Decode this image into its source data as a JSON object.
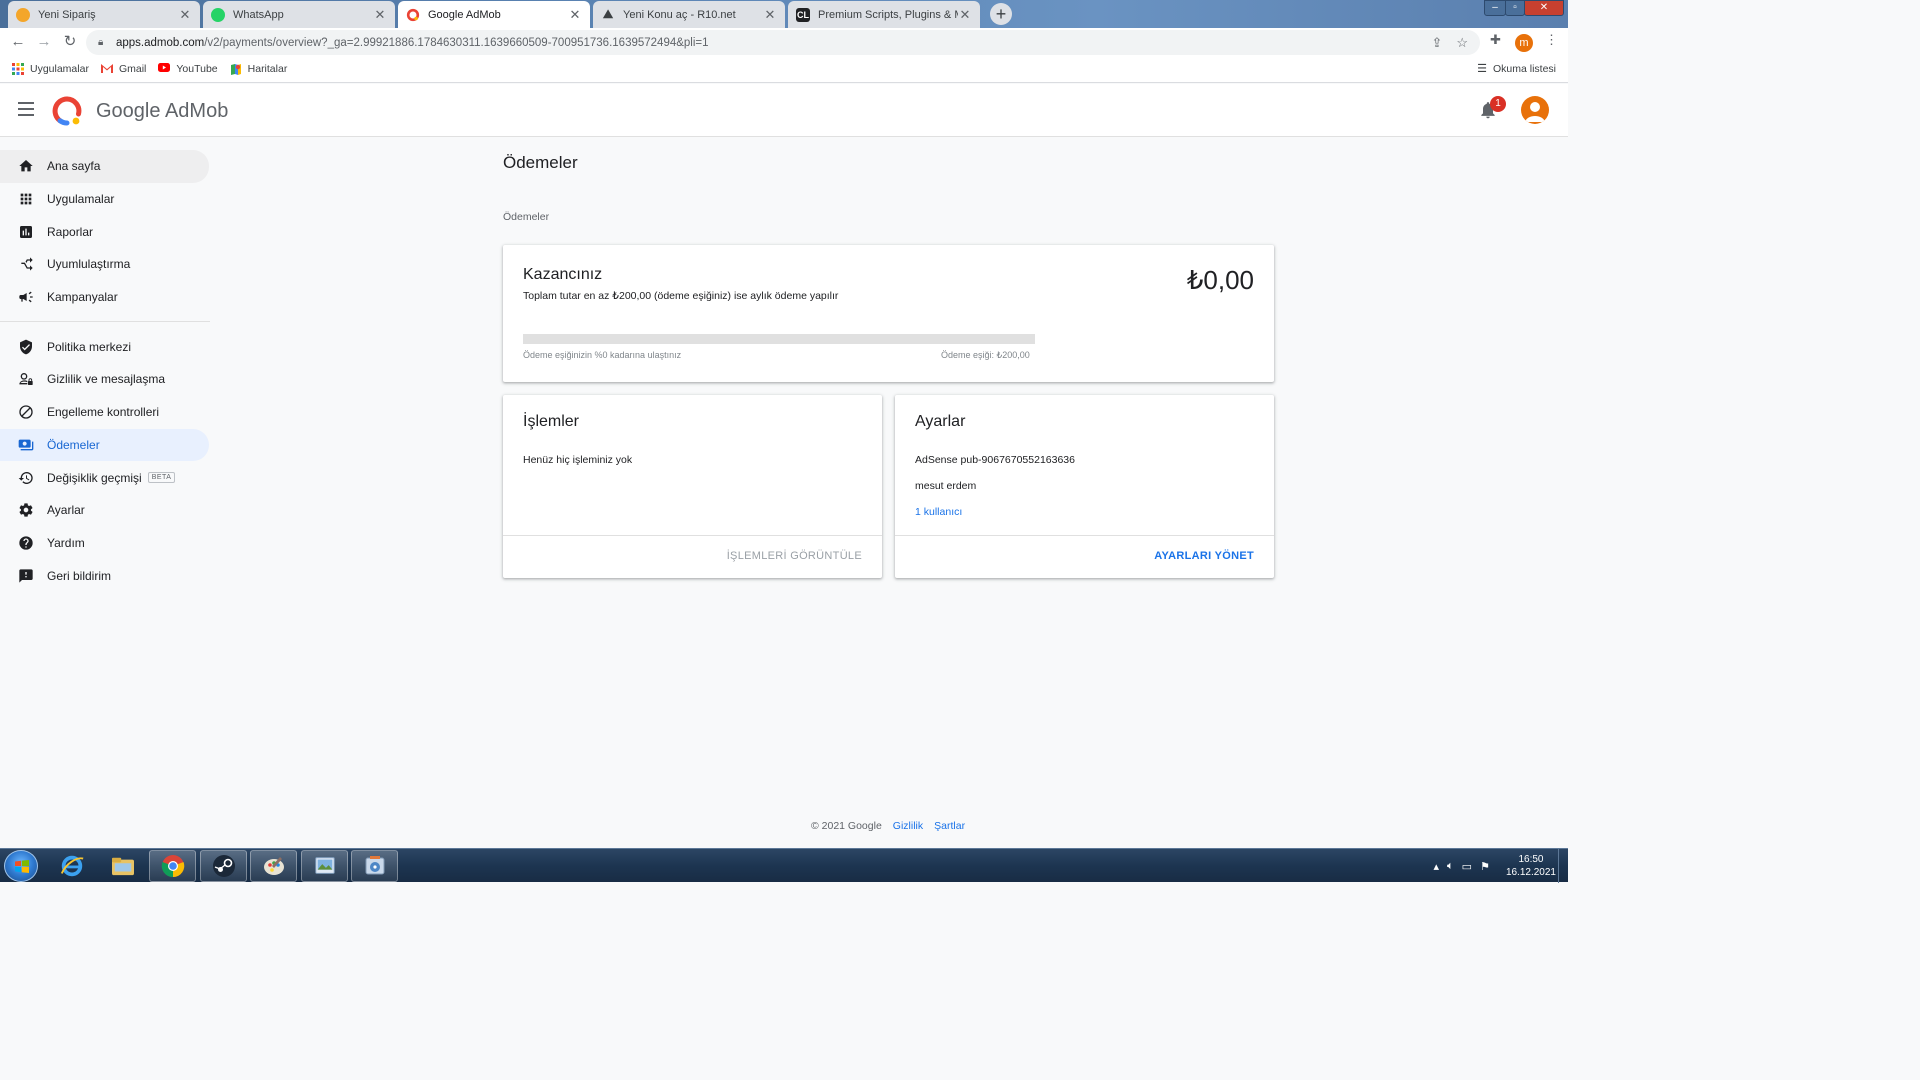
{
  "browser": {
    "tabs": [
      {
        "label": "Yeni Sipariş",
        "active": false
      },
      {
        "label": "WhatsApp",
        "active": false
      },
      {
        "label": "Google AdMob",
        "active": true
      },
      {
        "label": "Yeni Konu aç - R10.net",
        "active": false
      },
      {
        "label": "Premium Scripts, Plugins & Mobile",
        "active": false
      }
    ],
    "url_domain": "apps.admob.com",
    "url_path": "/v2/payments/overview?_ga=2.99921886.1784630311.1639660509-700951736.1639572494&pli=1",
    "profile_initial": "m",
    "bookmarks": [
      {
        "label": "Uygulamalar",
        "icon": "apps-grid-icon"
      },
      {
        "label": "Gmail",
        "icon": "gmail-icon"
      },
      {
        "label": "YouTube",
        "icon": "youtube-icon"
      },
      {
        "label": "Haritalar",
        "icon": "maps-icon"
      }
    ],
    "reading_list": "Okuma listesi"
  },
  "app": {
    "brand": "Google AdMob",
    "notification_count": "1"
  },
  "sidebar": {
    "items": [
      {
        "label": "Ana sayfa",
        "icon": "home-icon"
      },
      {
        "label": "Uygulamalar",
        "icon": "apps-icon"
      },
      {
        "label": "Raporlar",
        "icon": "reports-icon"
      },
      {
        "label": "Uyumlulaştırma",
        "icon": "mediation-icon"
      },
      {
        "label": "Kampanyalar",
        "icon": "campaigns-icon"
      },
      {
        "label": "Politika merkezi",
        "icon": "policy-shield-icon"
      },
      {
        "label": "Gizlilik ve mesajlaşma",
        "icon": "privacy-icon"
      },
      {
        "label": "Engelleme kontrolleri",
        "icon": "block-icon"
      },
      {
        "label": "Ödemeler",
        "icon": "payments-icon"
      },
      {
        "label": "Değişiklik geçmişi",
        "icon": "history-icon",
        "badge": "BETA"
      },
      {
        "label": "Ayarlar",
        "icon": "settings-gear-icon"
      },
      {
        "label": "Yardım",
        "icon": "help-icon"
      },
      {
        "label": "Geri bildirim",
        "icon": "feedback-icon"
      }
    ]
  },
  "main": {
    "title": "Ödemeler",
    "breadcrumb": "Ödemeler",
    "earnings": {
      "title": "Kazancınız",
      "subtitle": "Toplam tutar en az ₺200,00 (ödeme eşiğiniz) ise aylık ödeme yapılır",
      "amount": "₺0,00",
      "progress_percent": 0,
      "progress_left": "Ödeme eşiğinizin %0 kadarına ulaştınız",
      "progress_right": "Ödeme eşiği: ₺200,00"
    },
    "transactions": {
      "title": "İşlemler",
      "empty_text": "Henüz hiç işleminiz yok",
      "button": "İŞLEMLERİ GÖRÜNTÜLE"
    },
    "settings": {
      "title": "Ayarlar",
      "adsense": "AdSense pub-9067670552163636",
      "owner": "mesut erdem",
      "users_link": "1 kullanıcı",
      "button": "AYARLARI YÖNET"
    }
  },
  "footer": {
    "copyright": "© 2021 Google",
    "privacy": "Gizlilik",
    "terms": "Şartlar"
  },
  "taskbar": {
    "time": "16:50",
    "date": "16.12.2021"
  },
  "colors": {
    "accent": "#1a73e8",
    "selected_bg": "#e8f0fe",
    "avatar": "#e8710a",
    "badge": "#d93025"
  }
}
